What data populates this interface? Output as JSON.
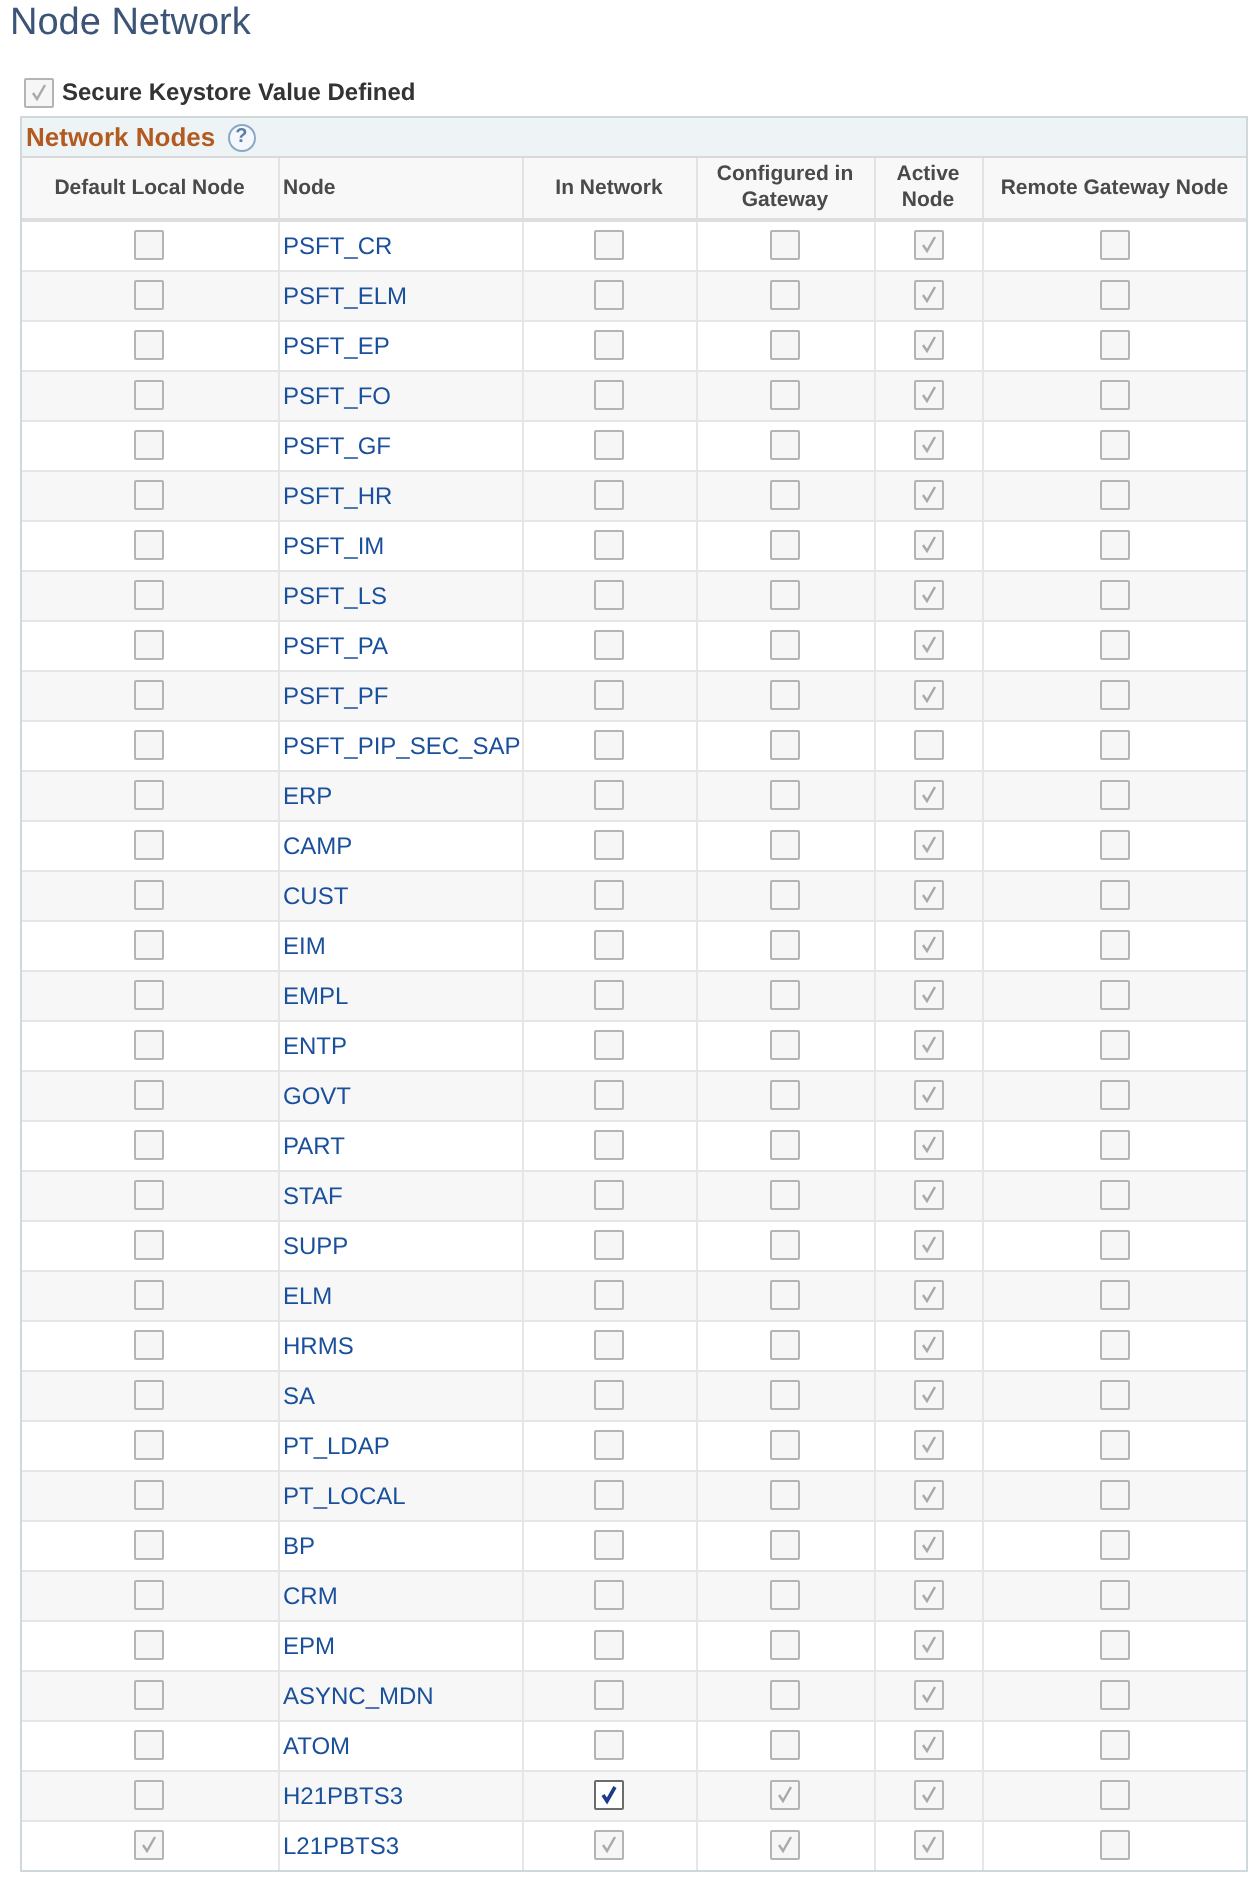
{
  "title": "Node Network",
  "keystore": {
    "label": "Secure Keystore Value Defined",
    "checked": true,
    "disabled": true
  },
  "grid": {
    "title": "Network Nodes",
    "help": "?",
    "columns": [
      "Default Local Node",
      "Node",
      "In Network",
      "Configured in Gateway",
      "Active Node",
      "Remote Gateway Node"
    ],
    "rows": [
      {
        "node": "PSFT_CR",
        "cells": [
          {
            "checked": false,
            "disabled": true
          },
          {
            "checked": false,
            "disabled": true
          },
          {
            "checked": false,
            "disabled": true
          },
          {
            "checked": true,
            "disabled": true
          },
          {
            "checked": false,
            "disabled": true
          }
        ]
      },
      {
        "node": "PSFT_ELM",
        "cells": [
          {
            "checked": false,
            "disabled": true
          },
          {
            "checked": false,
            "disabled": true
          },
          {
            "checked": false,
            "disabled": true
          },
          {
            "checked": true,
            "disabled": true
          },
          {
            "checked": false,
            "disabled": true
          }
        ]
      },
      {
        "node": "PSFT_EP",
        "cells": [
          {
            "checked": false,
            "disabled": true
          },
          {
            "checked": false,
            "disabled": true
          },
          {
            "checked": false,
            "disabled": true
          },
          {
            "checked": true,
            "disabled": true
          },
          {
            "checked": false,
            "disabled": true
          }
        ]
      },
      {
        "node": "PSFT_FO",
        "cells": [
          {
            "checked": false,
            "disabled": true
          },
          {
            "checked": false,
            "disabled": true
          },
          {
            "checked": false,
            "disabled": true
          },
          {
            "checked": true,
            "disabled": true
          },
          {
            "checked": false,
            "disabled": true
          }
        ]
      },
      {
        "node": "PSFT_GF",
        "cells": [
          {
            "checked": false,
            "disabled": true
          },
          {
            "checked": false,
            "disabled": true
          },
          {
            "checked": false,
            "disabled": true
          },
          {
            "checked": true,
            "disabled": true
          },
          {
            "checked": false,
            "disabled": true
          }
        ]
      },
      {
        "node": "PSFT_HR",
        "cells": [
          {
            "checked": false,
            "disabled": true
          },
          {
            "checked": false,
            "disabled": true
          },
          {
            "checked": false,
            "disabled": true
          },
          {
            "checked": true,
            "disabled": true
          },
          {
            "checked": false,
            "disabled": true
          }
        ]
      },
      {
        "node": "PSFT_IM",
        "cells": [
          {
            "checked": false,
            "disabled": true
          },
          {
            "checked": false,
            "disabled": true
          },
          {
            "checked": false,
            "disabled": true
          },
          {
            "checked": true,
            "disabled": true
          },
          {
            "checked": false,
            "disabled": true
          }
        ]
      },
      {
        "node": "PSFT_LS",
        "cells": [
          {
            "checked": false,
            "disabled": true
          },
          {
            "checked": false,
            "disabled": true
          },
          {
            "checked": false,
            "disabled": true
          },
          {
            "checked": true,
            "disabled": true
          },
          {
            "checked": false,
            "disabled": true
          }
        ]
      },
      {
        "node": "PSFT_PA",
        "cells": [
          {
            "checked": false,
            "disabled": true
          },
          {
            "checked": false,
            "disabled": true
          },
          {
            "checked": false,
            "disabled": true
          },
          {
            "checked": true,
            "disabled": true
          },
          {
            "checked": false,
            "disabled": true
          }
        ]
      },
      {
        "node": "PSFT_PF",
        "cells": [
          {
            "checked": false,
            "disabled": true
          },
          {
            "checked": false,
            "disabled": true
          },
          {
            "checked": false,
            "disabled": true
          },
          {
            "checked": true,
            "disabled": true
          },
          {
            "checked": false,
            "disabled": true
          }
        ]
      },
      {
        "node": "PSFT_PIP_SEC_SAP",
        "cells": [
          {
            "checked": false,
            "disabled": true
          },
          {
            "checked": false,
            "disabled": true
          },
          {
            "checked": false,
            "disabled": true
          },
          {
            "checked": false,
            "disabled": true
          },
          {
            "checked": false,
            "disabled": true
          }
        ]
      },
      {
        "node": "ERP",
        "cells": [
          {
            "checked": false,
            "disabled": true
          },
          {
            "checked": false,
            "disabled": true
          },
          {
            "checked": false,
            "disabled": true
          },
          {
            "checked": true,
            "disabled": true
          },
          {
            "checked": false,
            "disabled": true
          }
        ]
      },
      {
        "node": "CAMP",
        "cells": [
          {
            "checked": false,
            "disabled": true
          },
          {
            "checked": false,
            "disabled": true
          },
          {
            "checked": false,
            "disabled": true
          },
          {
            "checked": true,
            "disabled": true
          },
          {
            "checked": false,
            "disabled": true
          }
        ]
      },
      {
        "node": "CUST",
        "cells": [
          {
            "checked": false,
            "disabled": true
          },
          {
            "checked": false,
            "disabled": true
          },
          {
            "checked": false,
            "disabled": true
          },
          {
            "checked": true,
            "disabled": true
          },
          {
            "checked": false,
            "disabled": true
          }
        ]
      },
      {
        "node": "EIM",
        "cells": [
          {
            "checked": false,
            "disabled": true
          },
          {
            "checked": false,
            "disabled": true
          },
          {
            "checked": false,
            "disabled": true
          },
          {
            "checked": true,
            "disabled": true
          },
          {
            "checked": false,
            "disabled": true
          }
        ]
      },
      {
        "node": "EMPL",
        "cells": [
          {
            "checked": false,
            "disabled": true
          },
          {
            "checked": false,
            "disabled": true
          },
          {
            "checked": false,
            "disabled": true
          },
          {
            "checked": true,
            "disabled": true
          },
          {
            "checked": false,
            "disabled": true
          }
        ]
      },
      {
        "node": "ENTP",
        "cells": [
          {
            "checked": false,
            "disabled": true
          },
          {
            "checked": false,
            "disabled": true
          },
          {
            "checked": false,
            "disabled": true
          },
          {
            "checked": true,
            "disabled": true
          },
          {
            "checked": false,
            "disabled": true
          }
        ]
      },
      {
        "node": "GOVT",
        "cells": [
          {
            "checked": false,
            "disabled": true
          },
          {
            "checked": false,
            "disabled": true
          },
          {
            "checked": false,
            "disabled": true
          },
          {
            "checked": true,
            "disabled": true
          },
          {
            "checked": false,
            "disabled": true
          }
        ]
      },
      {
        "node": "PART",
        "cells": [
          {
            "checked": false,
            "disabled": true
          },
          {
            "checked": false,
            "disabled": true
          },
          {
            "checked": false,
            "disabled": true
          },
          {
            "checked": true,
            "disabled": true
          },
          {
            "checked": false,
            "disabled": true
          }
        ]
      },
      {
        "node": "STAF",
        "cells": [
          {
            "checked": false,
            "disabled": true
          },
          {
            "checked": false,
            "disabled": true
          },
          {
            "checked": false,
            "disabled": true
          },
          {
            "checked": true,
            "disabled": true
          },
          {
            "checked": false,
            "disabled": true
          }
        ]
      },
      {
        "node": "SUPP",
        "cells": [
          {
            "checked": false,
            "disabled": true
          },
          {
            "checked": false,
            "disabled": true
          },
          {
            "checked": false,
            "disabled": true
          },
          {
            "checked": true,
            "disabled": true
          },
          {
            "checked": false,
            "disabled": true
          }
        ]
      },
      {
        "node": "ELM",
        "cells": [
          {
            "checked": false,
            "disabled": true
          },
          {
            "checked": false,
            "disabled": true
          },
          {
            "checked": false,
            "disabled": true
          },
          {
            "checked": true,
            "disabled": true
          },
          {
            "checked": false,
            "disabled": true
          }
        ]
      },
      {
        "node": "HRMS",
        "cells": [
          {
            "checked": false,
            "disabled": true
          },
          {
            "checked": false,
            "disabled": true
          },
          {
            "checked": false,
            "disabled": true
          },
          {
            "checked": true,
            "disabled": true
          },
          {
            "checked": false,
            "disabled": true
          }
        ]
      },
      {
        "node": "SA",
        "cells": [
          {
            "checked": false,
            "disabled": true
          },
          {
            "checked": false,
            "disabled": true
          },
          {
            "checked": false,
            "disabled": true
          },
          {
            "checked": true,
            "disabled": true
          },
          {
            "checked": false,
            "disabled": true
          }
        ]
      },
      {
        "node": "PT_LDAP",
        "cells": [
          {
            "checked": false,
            "disabled": true
          },
          {
            "checked": false,
            "disabled": true
          },
          {
            "checked": false,
            "disabled": true
          },
          {
            "checked": true,
            "disabled": true
          },
          {
            "checked": false,
            "disabled": true
          }
        ]
      },
      {
        "node": "PT_LOCAL",
        "cells": [
          {
            "checked": false,
            "disabled": true
          },
          {
            "checked": false,
            "disabled": true
          },
          {
            "checked": false,
            "disabled": true
          },
          {
            "checked": true,
            "disabled": true
          },
          {
            "checked": false,
            "disabled": true
          }
        ]
      },
      {
        "node": "BP",
        "cells": [
          {
            "checked": false,
            "disabled": true
          },
          {
            "checked": false,
            "disabled": true
          },
          {
            "checked": false,
            "disabled": true
          },
          {
            "checked": true,
            "disabled": true
          },
          {
            "checked": false,
            "disabled": true
          }
        ]
      },
      {
        "node": "CRM",
        "cells": [
          {
            "checked": false,
            "disabled": true
          },
          {
            "checked": false,
            "disabled": true
          },
          {
            "checked": false,
            "disabled": true
          },
          {
            "checked": true,
            "disabled": true
          },
          {
            "checked": false,
            "disabled": true
          }
        ]
      },
      {
        "node": "EPM",
        "cells": [
          {
            "checked": false,
            "disabled": true
          },
          {
            "checked": false,
            "disabled": true
          },
          {
            "checked": false,
            "disabled": true
          },
          {
            "checked": true,
            "disabled": true
          },
          {
            "checked": false,
            "disabled": true
          }
        ]
      },
      {
        "node": "ASYNC_MDN",
        "cells": [
          {
            "checked": false,
            "disabled": true
          },
          {
            "checked": false,
            "disabled": true
          },
          {
            "checked": false,
            "disabled": true
          },
          {
            "checked": true,
            "disabled": true
          },
          {
            "checked": false,
            "disabled": true
          }
        ]
      },
      {
        "node": "ATOM",
        "cells": [
          {
            "checked": false,
            "disabled": true
          },
          {
            "checked": false,
            "disabled": true
          },
          {
            "checked": false,
            "disabled": true
          },
          {
            "checked": true,
            "disabled": true
          },
          {
            "checked": false,
            "disabled": true
          }
        ]
      },
      {
        "node": "H21PBTS3",
        "cells": [
          {
            "checked": false,
            "disabled": true
          },
          {
            "checked": true,
            "disabled": false
          },
          {
            "checked": true,
            "disabled": true
          },
          {
            "checked": true,
            "disabled": true
          },
          {
            "checked": false,
            "disabled": true
          }
        ]
      },
      {
        "node": "L21PBTS3",
        "cells": [
          {
            "checked": true,
            "disabled": true
          },
          {
            "checked": true,
            "disabled": true
          },
          {
            "checked": true,
            "disabled": true
          },
          {
            "checked": true,
            "disabled": true
          },
          {
            "checked": false,
            "disabled": true
          }
        ]
      }
    ]
  }
}
